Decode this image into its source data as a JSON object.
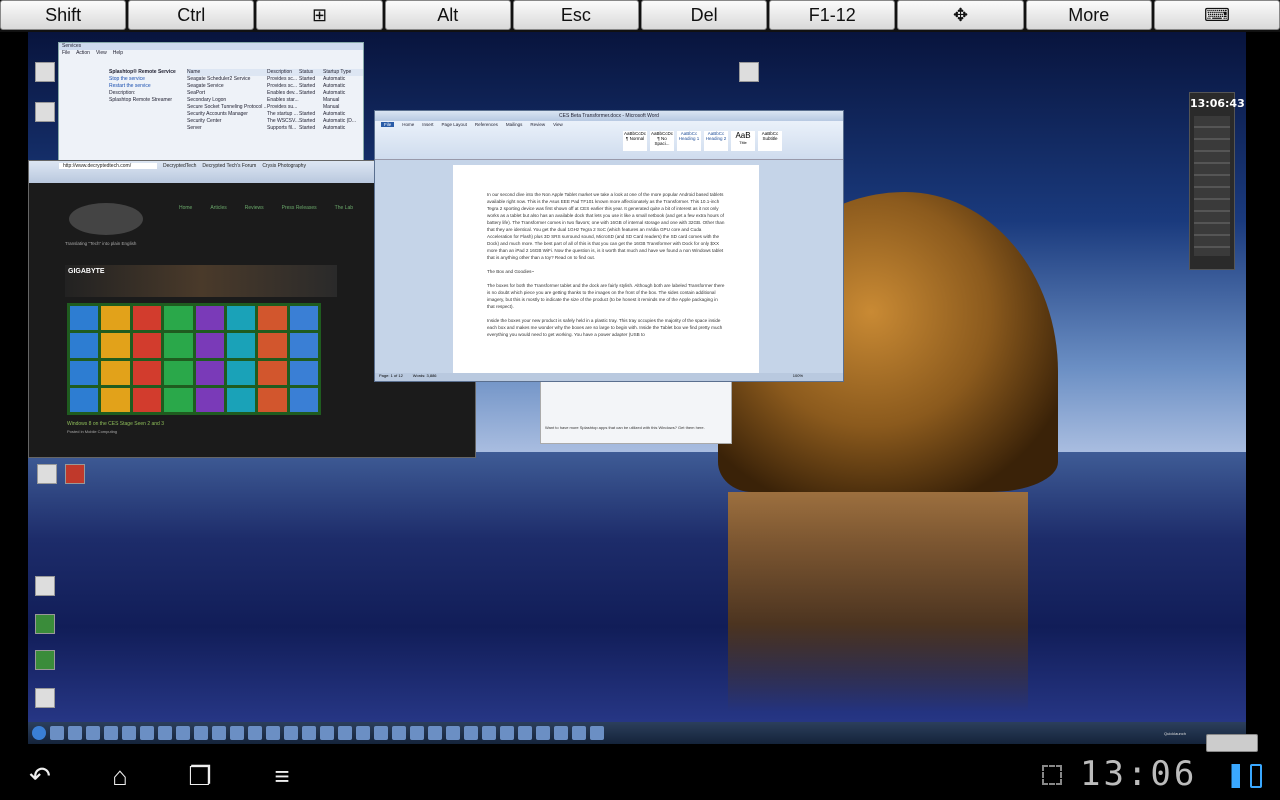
{
  "keybar": {
    "keys": [
      "Shift",
      "Ctrl",
      "⊞",
      "Alt",
      "Esc",
      "Del",
      "F1-12",
      "✥",
      "More",
      "⌨"
    ]
  },
  "gadget": {
    "clock": "13:06:43"
  },
  "services_window": {
    "title": "Services",
    "menu": [
      "File",
      "Action",
      "View",
      "Help"
    ],
    "heading": "Splashtop® Remote Service",
    "links": [
      "Stop the service",
      "Restart the service"
    ],
    "description_label": "Description:",
    "description": "Splashtop Remote Streamer",
    "columns": [
      "Name",
      "Description",
      "Status",
      "Startup Type"
    ],
    "rows": [
      [
        "Seagate Scheduler2 Service",
        "Provides sc...",
        "Started",
        "Automatic"
      ],
      [
        "Seagate Service",
        "Provides sc...",
        "Started",
        "Automatic"
      ],
      [
        "SeaPort",
        "Enables dev...",
        "Started",
        "Automatic"
      ],
      [
        "Secondary Logon",
        "Enables star...",
        "",
        "Manual"
      ],
      [
        "Secure Socket Tunneling Protocol ...",
        "Provides su...",
        "",
        "Manual"
      ],
      [
        "Security Accounts Manager",
        "The startup ...",
        "Started",
        "Automatic"
      ],
      [
        "Security Center",
        "The WSCSV...",
        "Started",
        "Automatic (D..."
      ],
      [
        "Server",
        "Supports fil...",
        "Started",
        "Automatic"
      ]
    ]
  },
  "browser_window": {
    "url": "http://www.decryptedtech.com/",
    "tabs": [
      "DecryptedTech",
      "Decrypted Tech's Forum",
      "Crysis Photography"
    ],
    "nav": [
      "Home",
      "Articles",
      "Reviews",
      "Press Releases",
      "The Lab"
    ],
    "tagline": "Translating \"Tech\" into plain English",
    "banner": "GIGABYTE",
    "caption": "Windows 8 on the CES Stage Seen 2 and 3",
    "caption_sub": "Posted in Mobile Computing"
  },
  "word_window": {
    "title": "CES Beta Transformer.docx - Microsoft Word",
    "tabs": [
      "File",
      "Home",
      "Insert",
      "Page Layout",
      "References",
      "Mailings",
      "Review",
      "View"
    ],
    "styles": [
      "AaBbCcDc",
      "AaBbCcDc",
      "AaBbCc",
      "AaBbCc",
      "AaB",
      "AaBbCc"
    ],
    "style_names": [
      "¶ Normal",
      "¶ No Spaci...",
      "Heading 1",
      "Heading 2",
      "Title",
      "Subtitle"
    ],
    "paragraphs": [
      "In our second dive into the Non Apple Tablet market we take a look at one of the more popular Android based tablets available right now. This is the Asus EEE Pad TF101 known more affectionately as the Transformer. This 10.1-inch Tegra 2 sporting device was first shown off at CES earlier this year. It generated quite a bit of interest as it not only works as a tablet but also has an available dock that lets you use it like a small netbook (and get a few extra hours of battery life). The Transformer comes in two flavors; one with 16GB of internal storage and one with 32GB. Other than that they are identical. You get the dual 1GHz Tegra 2 SoC (which features an nVidia GPU core and Cuda Acceleration for Flash) plus 3D SRS surround sound, MicroSD (and SD Card readers) the SD card comes with the Dock) and much more. The best part of all of this is that you can get the 16GB Transformer with Dock for only $XX more than an iPad 2 16GB WiFi. Now the question is, is it worth that much and have we found a non Windows tablet that is anything other than a toy? Read on to find out.",
      "The Box and Goodies~",
      "The boxes for both the Transformer tablet and the dock are fairly stylish. Although both are labeled Transformer there is no doubt which piece you are getting thanks to the images on the front of the box. The sides contain additional imagery, but this is mostly to indicate the size of the product (to be honest it reminds me of the Apple packaging in that respect).",
      "Inside the boxes your new product is safely held in a plastic tray. This tray occupies the majority of the space inside each box and makes me wonder why the boxes are so large to begin with. Inside the Tablet box we find pretty much everything you would need to get working. You have a power adapter (USB to"
    ],
    "status_left": "Page: 1 of 12",
    "status_words": "Words: 3,886",
    "zoom": "100%"
  },
  "splashtop_panel": {
    "text": "Want to have more Splashtop apps that can be utilized with this Windows? Get them here."
  },
  "taskbar": {
    "label": "Quicklaunch"
  },
  "android": {
    "time": "13:06"
  }
}
